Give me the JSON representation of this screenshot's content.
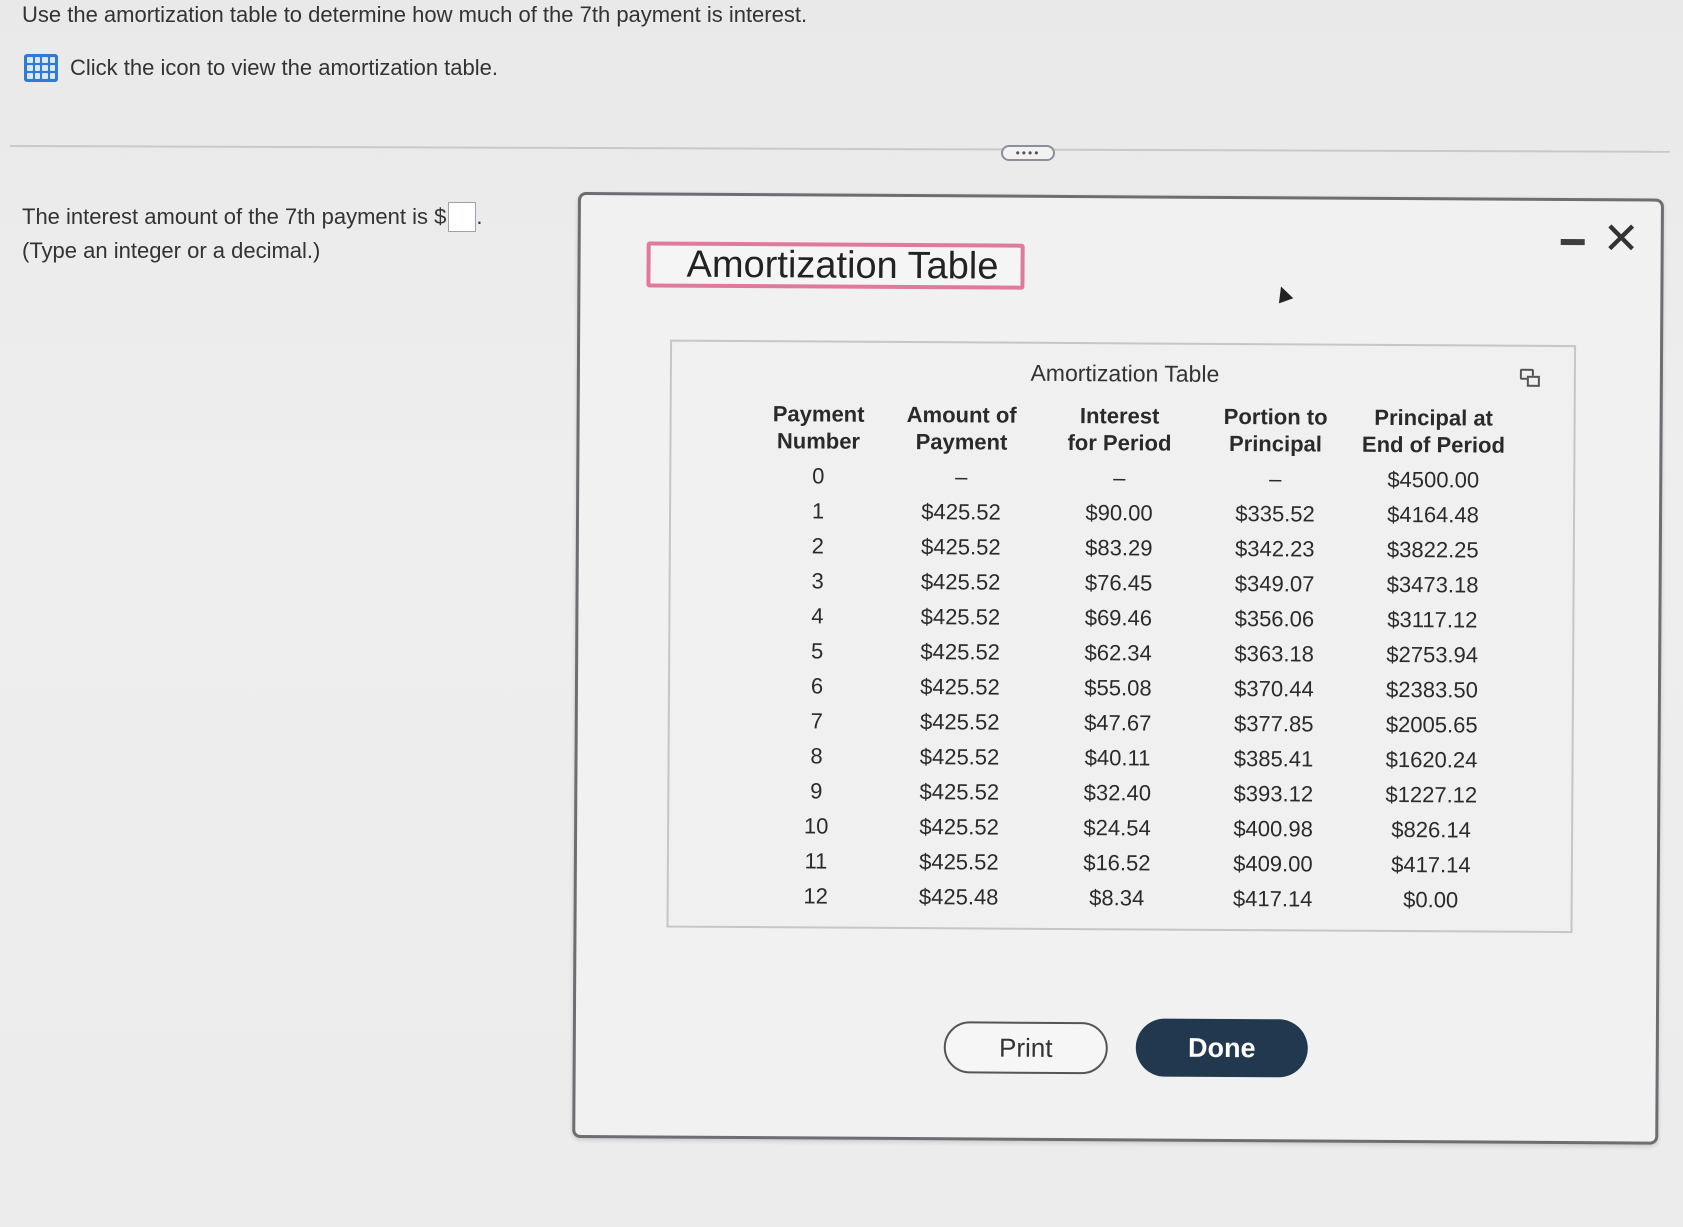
{
  "question": "Use the amortization table to determine how much of the 7th payment is interest.",
  "icon_prompt": {
    "icon": "grid-table-icon",
    "label": "Click the icon to view the amortization table."
  },
  "more_button": {
    "label": "••••"
  },
  "answer": {
    "prefix": "The interest amount of the 7th payment is $",
    "suffix": ".",
    "value": "",
    "hint": "(Type an integer or a decimal.)"
  },
  "dialog": {
    "title": "Amortization Table",
    "minimize_icon": "minimize-icon",
    "close_glyph": "✕",
    "table": {
      "caption": "Amortization Table",
      "headers": [
        [
          "Payment",
          "Number"
        ],
        [
          "Amount of",
          "Payment"
        ],
        [
          "Interest",
          "for Period"
        ],
        [
          "Portion to",
          "Principal"
        ],
        [
          "Principal at",
          "End of Period"
        ]
      ],
      "rows": [
        [
          "0",
          "–",
          "–",
          "–",
          "$4500.00"
        ],
        [
          "1",
          "$425.52",
          "$90.00",
          "$335.52",
          "$4164.48"
        ],
        [
          "2",
          "$425.52",
          "$83.29",
          "$342.23",
          "$3822.25"
        ],
        [
          "3",
          "$425.52",
          "$76.45",
          "$349.07",
          "$3473.18"
        ],
        [
          "4",
          "$425.52",
          "$69.46",
          "$356.06",
          "$3117.12"
        ],
        [
          "5",
          "$425.52",
          "$62.34",
          "$363.18",
          "$2753.94"
        ],
        [
          "6",
          "$425.52",
          "$55.08",
          "$370.44",
          "$2383.50"
        ],
        [
          "7",
          "$425.52",
          "$47.67",
          "$377.85",
          "$2005.65"
        ],
        [
          "8",
          "$425.52",
          "$40.11",
          "$385.41",
          "$1620.24"
        ],
        [
          "9",
          "$425.52",
          "$32.40",
          "$393.12",
          "$1227.12"
        ],
        [
          "10",
          "$425.52",
          "$24.54",
          "$400.98",
          "$826.14"
        ],
        [
          "11",
          "$425.52",
          "$16.52",
          "$409.00",
          "$417.14"
        ],
        [
          "12",
          "$425.48",
          "$8.34",
          "$417.14",
          "$0.00"
        ]
      ]
    },
    "print_label": "Print",
    "done_label": "Done"
  },
  "colors": {
    "accent": "#2f7bd6",
    "done_button": "#22384e",
    "title_border": "#e07a9a"
  }
}
